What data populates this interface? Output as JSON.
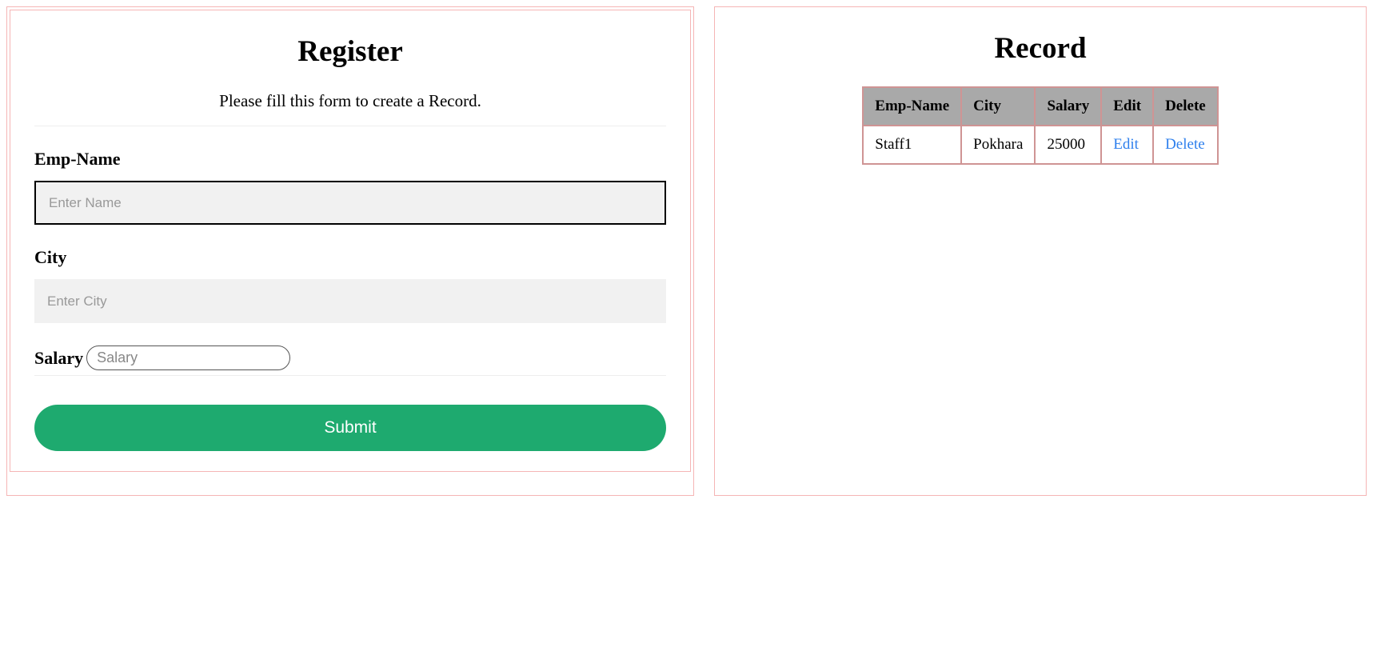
{
  "register": {
    "title": "Register",
    "subtitle": "Please fill this form to create a Record.",
    "fields": {
      "name": {
        "label": "Emp-Name",
        "placeholder": "Enter Name",
        "value": ""
      },
      "city": {
        "label": "City",
        "placeholder": "Enter City",
        "value": ""
      },
      "salary": {
        "label": "Salary",
        "placeholder": "Salary",
        "value": ""
      }
    },
    "submit_label": "Submit"
  },
  "record": {
    "title": "Record",
    "headers": [
      "Emp-Name",
      "City",
      "Salary",
      "Edit",
      "Delete"
    ],
    "rows": [
      {
        "name": "Staff1",
        "city": "Pokhara",
        "salary": "25000",
        "edit_label": "Edit",
        "delete_label": "Delete"
      }
    ]
  }
}
